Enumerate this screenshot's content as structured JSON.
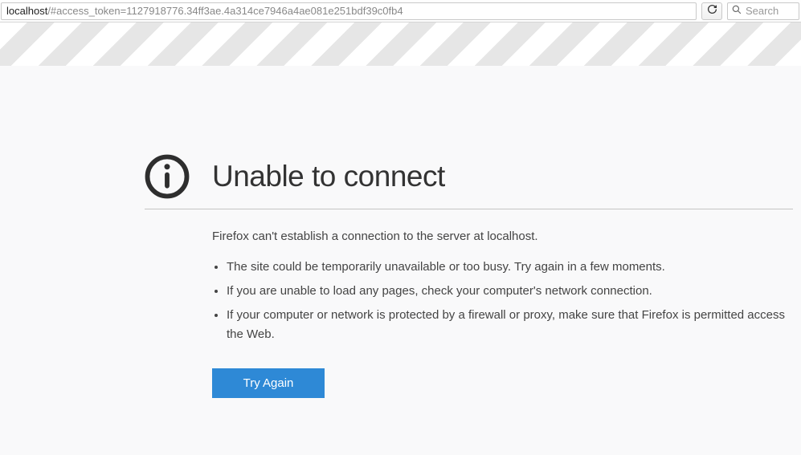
{
  "toolbar": {
    "url_host": "localhost",
    "url_rest": "/#access_token=1127918776.34ff3ae.4a314ce7946a4ae081e251bdf39c0fb4",
    "search_placeholder": "Search"
  },
  "error": {
    "title": "Unable to connect",
    "description": "Firefox can't establish a connection to the server at localhost.",
    "tips": [
      "The site could be temporarily unavailable or too busy. Try again in a few moments.",
      "If you are unable to load any pages, check your computer's network connection.",
      "If your computer or network is protected by a firewall or proxy, make sure that Firefox is permitted access the Web."
    ],
    "try_again_label": "Try Again"
  }
}
